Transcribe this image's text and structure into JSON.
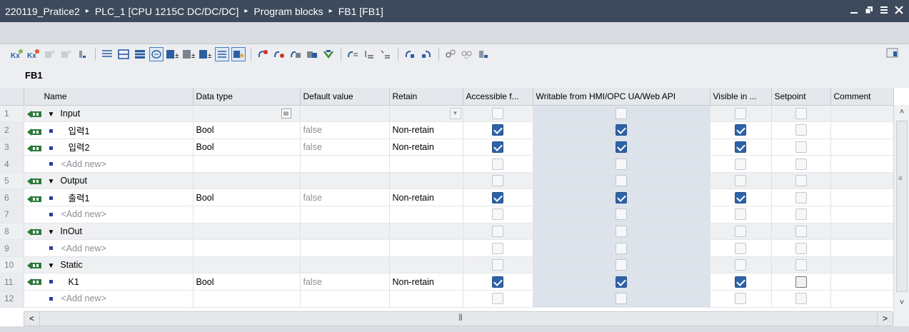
{
  "titlebar": {
    "crumbs": [
      "220119_Pratice2",
      "PLC_1 [CPU 1215C DC/DC/DC]",
      "Program blocks",
      "FB1 [FB1]"
    ],
    "separator": "▸",
    "controls": [
      "minimize-icon",
      "restore-icon",
      "menu-icon",
      "close-icon"
    ],
    "background": "#3c4a5c"
  },
  "block": {
    "name": "FB1"
  },
  "table": {
    "headers": {
      "name": "Name",
      "data_type": "Data type",
      "default_value": "Default value",
      "retain": "Retain",
      "accessible": "Accessible f...",
      "writable": "Writable from HMI/OPC UA/Web API",
      "visible": "Visible in ...",
      "setpoint": "Setpoint",
      "comment": "Comment"
    },
    "rows": [
      {
        "num": "1",
        "section": true,
        "name": "Input",
        "type": "",
        "default": "",
        "retain": "",
        "acc": false,
        "wr": false,
        "vis": false,
        "sp": false
      },
      {
        "num": "2",
        "section": false,
        "name": "입력1",
        "type": "Bool",
        "default": "false",
        "retain": "Non-retain",
        "acc": true,
        "wr": true,
        "vis": true,
        "sp": false
      },
      {
        "num": "3",
        "section": false,
        "name": "입력2",
        "type": "Bool",
        "default": "false",
        "retain": "Non-retain",
        "acc": true,
        "wr": true,
        "vis": true,
        "sp": false
      },
      {
        "num": "4",
        "section": false,
        "addnew": true,
        "name": "<Add new>",
        "type": "",
        "default": "",
        "retain": "",
        "acc": false,
        "wr": false,
        "vis": false,
        "sp": false
      },
      {
        "num": "5",
        "section": true,
        "name": "Output",
        "type": "",
        "default": "",
        "retain": "",
        "acc": false,
        "wr": false,
        "vis": false,
        "sp": false
      },
      {
        "num": "6",
        "section": false,
        "name": "출력1",
        "type": "Bool",
        "default": "false",
        "retain": "Non-retain",
        "acc": true,
        "wr": true,
        "vis": true,
        "sp": false
      },
      {
        "num": "7",
        "section": false,
        "addnew": true,
        "name": "<Add new>",
        "type": "",
        "default": "",
        "retain": "",
        "acc": false,
        "wr": false,
        "vis": false,
        "sp": false
      },
      {
        "num": "8",
        "section": true,
        "name": "InOut",
        "type": "",
        "default": "",
        "retain": "",
        "acc": false,
        "wr": false,
        "vis": false,
        "sp": false
      },
      {
        "num": "9",
        "section": false,
        "addnew": true,
        "name": "<Add new>",
        "type": "",
        "default": "",
        "retain": "",
        "acc": false,
        "wr": false,
        "vis": false,
        "sp": false
      },
      {
        "num": "10",
        "section": true,
        "name": "Static",
        "type": "",
        "default": "",
        "retain": "",
        "acc": false,
        "wr": false,
        "vis": false,
        "sp": false
      },
      {
        "num": "11",
        "section": false,
        "name": "K1",
        "type": "Bool",
        "default": "false",
        "retain": "Non-retain",
        "acc": true,
        "wr": true,
        "vis": true,
        "sp": false,
        "sp_dark": true
      },
      {
        "num": "12",
        "section": false,
        "addnew": true,
        "name": "<Add new>",
        "type": "",
        "default": "",
        "retain": "",
        "acc": false,
        "wr": false,
        "vis": false,
        "sp": false
      }
    ]
  },
  "colors": {
    "check_on": "#2d62a8",
    "hmi_column": "#dce3ea",
    "io_icon": "#2b7a3c"
  }
}
